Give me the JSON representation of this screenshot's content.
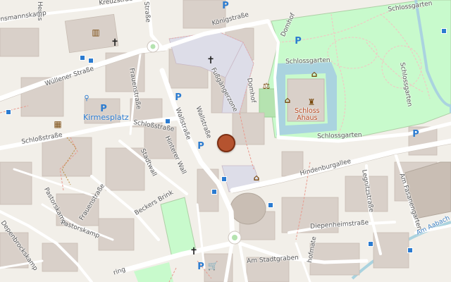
{
  "streets": {
    "heuss": "Heuss",
    "kreuzstrasse": "Kreuzstraße",
    "strasse_top": "Straße",
    "koenigstrasse": "Königstraße",
    "mannskamp": "nsmannskamp",
    "wuellener_strasse": "Wüllener Straße",
    "frauenstrasse_top": "Frauenstraße",
    "fussgaengerzone": "Fußgängerzone",
    "domhof_top": "Domhof",
    "domhof_side": "Domhof",
    "schlossgarten_top": "Schlossgarten",
    "schlossgarten_left": "Schlossgarten",
    "schlossgarten_right": "Schlossgarten",
    "schlossgarten_bottom": "Schlossgarten",
    "schlossstrasse_left": "Schloßstraße",
    "schlossstrasse_mid": "Schloßstraße",
    "wallstrasse_a": "Wallstraße",
    "wallstrasse_b": "Wallstraße",
    "stadtwall": "Stadtwall",
    "hinterer_wall": "Hinterer Wall",
    "pastorskamp_a": "Pastorskamp",
    "pastorskamp_b": "Pastorskamp",
    "frauenstrasse_low": "Frauenstraße",
    "beckers_brink": "Beckers Brink",
    "depenbrockskamp": "Depenbrockskamp",
    "hindenburgallee": "Hindenburgallee",
    "legnitzstrasse": "Legnitzstraße",
    "am_fasanengarten": "Am Fasanengarten",
    "diepenheimstrasse": "Diepenheimstraße",
    "am_aabach": "Am Aabach",
    "am_stadtgraben": "Am Stadtgraben",
    "ring": "ring",
    "hofmate": "hofmate"
  },
  "places": {
    "kirmesplatz": "Kirmesplatz",
    "schloss_ahaus": [
      "Schloss",
      "Ahaus"
    ]
  },
  "map": {
    "marker_color": "#b5532f",
    "water_color": "#aad3df",
    "park_color": "#c8facc",
    "building_color": "#d9d0c9",
    "pedestrian_color": "#dddde8"
  }
}
